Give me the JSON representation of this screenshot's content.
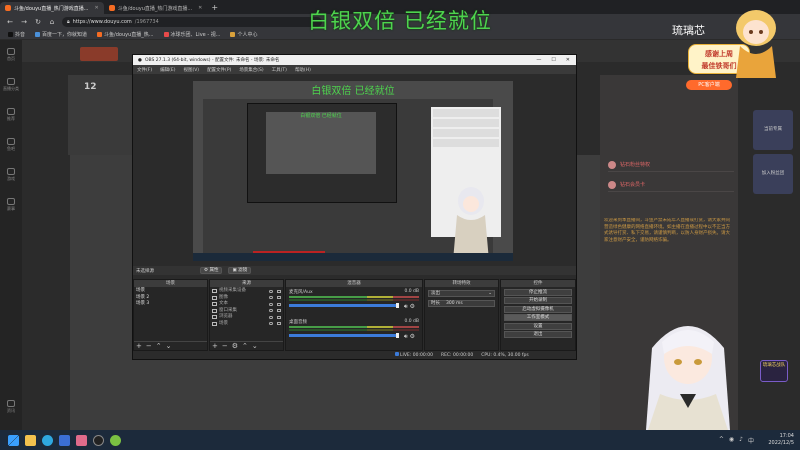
{
  "browser": {
    "tabs": [
      {
        "label": "斗鱼/douyu直播_热门游戏直播...",
        "active": true
      },
      {
        "label": "斗鱼/douyu直播_热门游戏直播...",
        "active": false
      }
    ],
    "new_tab": "+",
    "url_host": "https://www.douyu.com",
    "url_path": "/1967734",
    "bookmarks": [
      "抖音",
      "百度一下，你就知道",
      "斗鱼/douyu直播_热...",
      "冰球乐团、Live - 视...",
      "个人中心"
    ]
  },
  "site": {
    "left_nav": [
      "首页",
      "直播分类",
      "推荐",
      "鱼吧",
      "游戏",
      "赛事",
      "资讯"
    ],
    "room_number": "12",
    "orange_button": "PC客户端",
    "right_rows": [
      "钻石粉丝特权",
      "钻石会员卡"
    ],
    "chat_text": "欢迎来到本直播间，斗鱼严禁未成年人直播或打赏，请大家共同营造绿色健康的网络直播环境。如主播在直播过程中以不正当方式诱导打赏、私下交易，请谨慎判断，以防人身财产损失。请大家注意财产安全，谨防网络诈骗。",
    "right_cards": [
      "当前专属",
      "加入粉丝团"
    ]
  },
  "overlay": {
    "banner": "白银双倍 已经就位",
    "streamer_name": "琉璃芯",
    "bubble_line1": "感谢上周",
    "bubble_line2": "最佳铁哥们"
  },
  "obs": {
    "title": "OBS 27.1.3 (64-bit, windows) - 配置文件: 未命名 - 场景: 未命名",
    "window_controls": [
      "—",
      "☐",
      "✕"
    ],
    "menu": [
      "文件(F)",
      "编辑(E)",
      "视图(V)",
      "配置文件(P)",
      "场景集合(S)",
      "工具(T)",
      "帮助(H)"
    ],
    "preview_banner": "白银双倍 已经就位",
    "scene_bar_label": "未选择源",
    "scene_bar_buttons": [
      "⚙ 属性",
      "▣ 滤镜"
    ],
    "docks": {
      "scenes": {
        "title": "场景",
        "items": [
          "场景",
          "场景 2",
          "场景 3"
        ]
      },
      "sources": {
        "title": "来源",
        "items": [
          "视频采集设备",
          "图像",
          "文本",
          "窗口采集",
          "浏览器",
          "场景"
        ]
      },
      "mixer": {
        "title": "混音器",
        "tracks": [
          {
            "name": "麦克风/Aux",
            "db": "0.0 dB"
          },
          {
            "name": "桌面音频",
            "db": "0.0 dB"
          }
        ]
      },
      "transitions": {
        "title": "转场特效",
        "type": "淡出",
        "duration_label": "时长",
        "duration": "300 ms"
      },
      "controls": {
        "title": "控件",
        "buttons": [
          "停止推流",
          "开始录制",
          "启动虚拟摄像机",
          "工作室模式",
          "设置",
          "退出"
        ]
      }
    },
    "statusbar": {
      "live_label": "LIVE:",
      "live_time": "00:00:00",
      "rec_label": "REC:",
      "rec_time": "00:00:00",
      "cpu": "CPU: 0.4%, 30.00 fps"
    }
  },
  "taskbar": {
    "time": "17:04",
    "date": "2022/12/5",
    "tray": [
      "^",
      "◉",
      "♪",
      "中"
    ]
  },
  "game_badge": "琉璃芯战队",
  "colors": {
    "banner_green": "#4ed44e",
    "douyu_orange": "#ff6a2c",
    "obs_blue": "#3c7bd9"
  }
}
